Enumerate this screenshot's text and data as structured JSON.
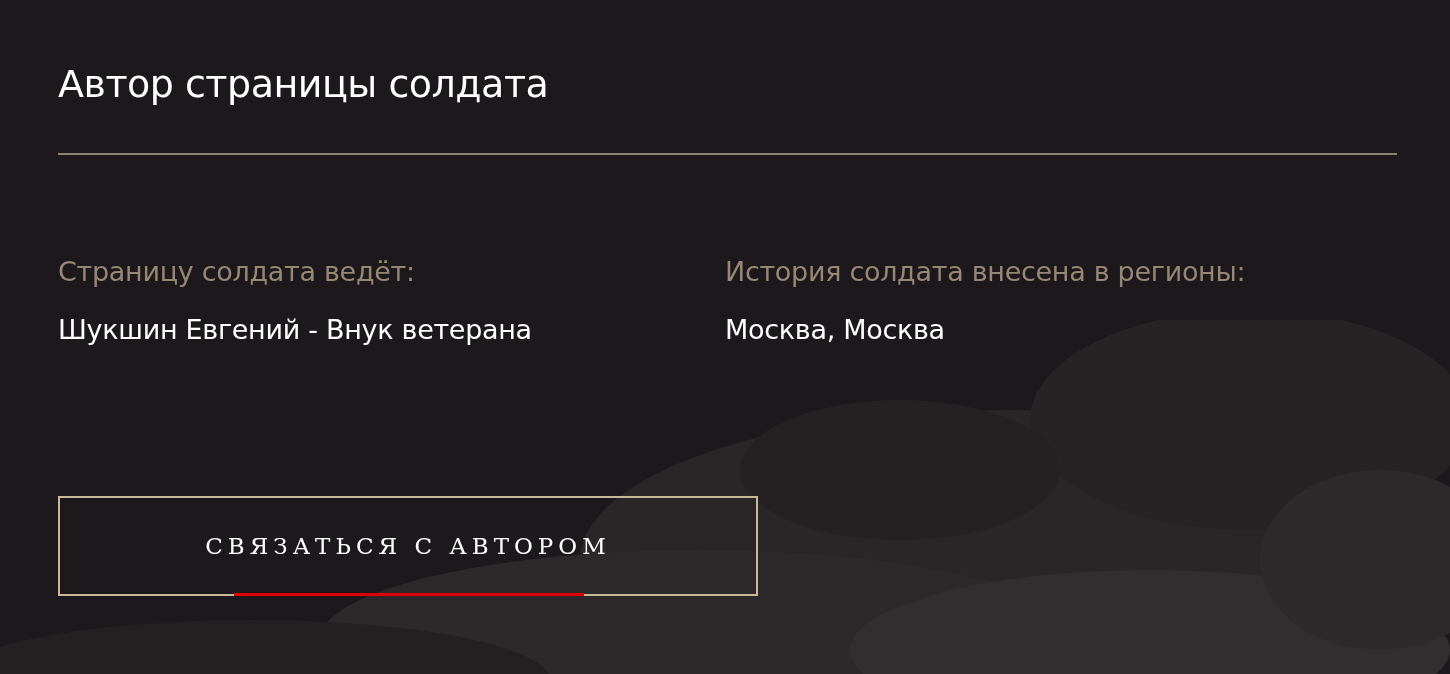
{
  "title": "Автор страницы солдата",
  "fields": [
    {
      "label": "Страницу солдата ведёт:",
      "value": "Шукшин Евгений - Внук ветерана"
    },
    {
      "label": "История солдата внесена в регионы:",
      "value": "Москва, Москва"
    }
  ],
  "button": {
    "label": "СВЯЗАТЬСЯ С АВТОРОМ"
  }
}
